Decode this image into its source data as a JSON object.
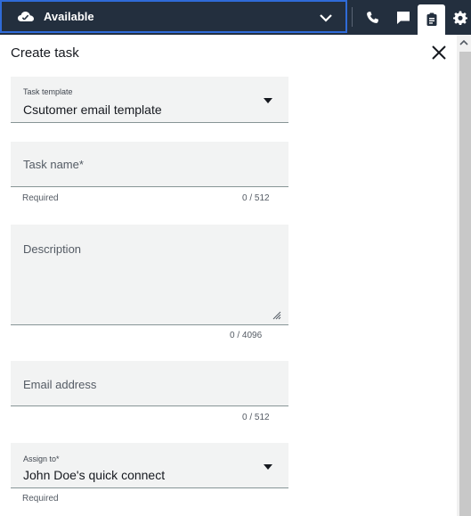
{
  "status_bar": {
    "status_label": "Available",
    "cloud_icon": "cloud-icon",
    "dropdown_icon": "chevron-down-icon",
    "tools": [
      "phone-icon",
      "chat-icon",
      "task-icon",
      "gear-icon"
    ]
  },
  "panel": {
    "title": "Create task",
    "close_icon": "close-icon"
  },
  "form": {
    "task_template": {
      "label": "Task template",
      "value": "Csutomer email template"
    },
    "task_name": {
      "placeholder": "Task name*",
      "helper": "Required",
      "counter": "0 / 512"
    },
    "description": {
      "placeholder": "Description",
      "counter": "0 / 4096"
    },
    "email_address": {
      "placeholder": "Email address",
      "counter": "0 / 512"
    },
    "assign_to": {
      "label": "Assign to*",
      "value": "John Doe's quick connect",
      "helper": "Required"
    }
  },
  "colors": {
    "topbar": "#232f3e",
    "focus_border": "#2f6bd8",
    "field_bg": "#f2f3f3"
  }
}
